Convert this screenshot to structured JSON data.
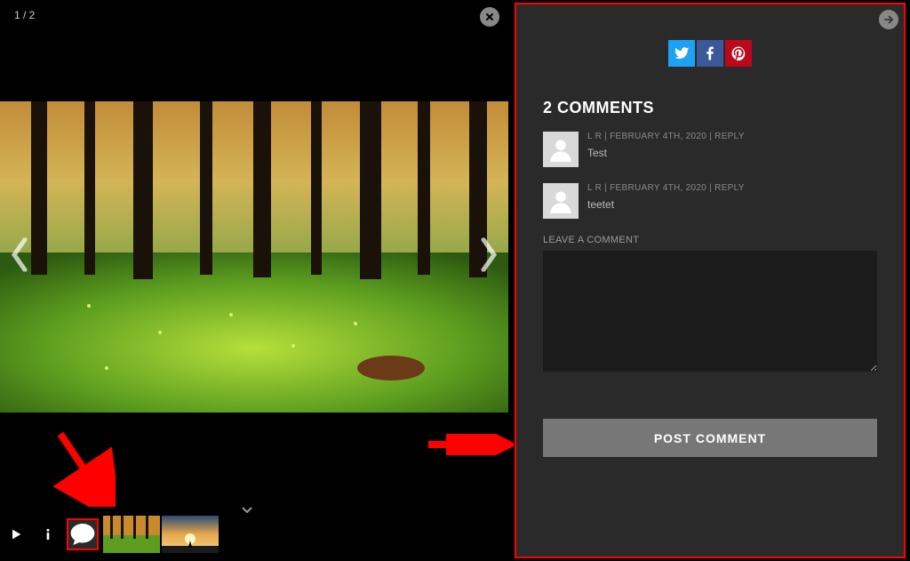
{
  "viewer": {
    "counter": "1 / 2"
  },
  "panel": {
    "comments_heading": "2 COMMENTS",
    "comments": [
      {
        "meta": "L R | FEBRUARY 4TH, 2020 | ",
        "reply": "REPLY",
        "text": "Test"
      },
      {
        "meta": "L R | FEBRUARY 4TH, 2020 | ",
        "reply": "REPLY",
        "text": "teetet"
      }
    ],
    "leave_label": "LEAVE A COMMENT",
    "post_button": "POST COMMENT"
  },
  "social": {
    "twitter": "twitter-icon",
    "facebook": "facebook-icon",
    "pinterest": "pinterest-icon"
  },
  "colors": {
    "twitter": "#1da1f2",
    "facebook": "#3b5998",
    "pinterest": "#bd081c",
    "annotation": "#ff0000",
    "panel_bg": "#2a2a2a",
    "button_bg": "#777777"
  }
}
